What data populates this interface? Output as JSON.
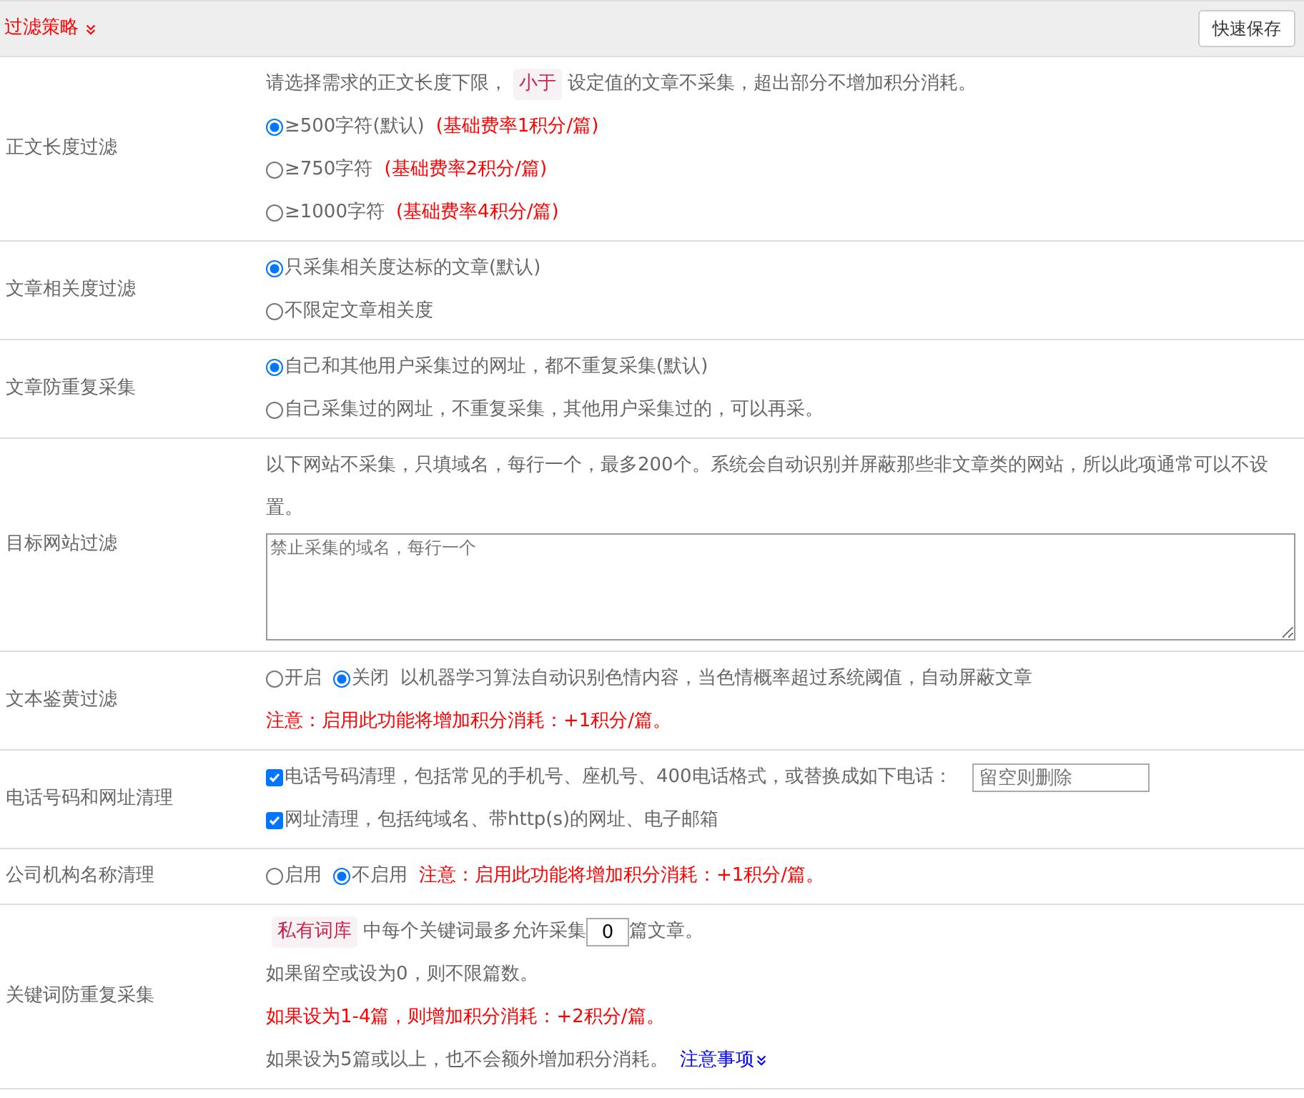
{
  "header": {
    "title": "过滤策略",
    "save_button": "快速保存"
  },
  "rows": [
    {
      "label": "正文长度过滤",
      "lines": [
        [
          {
            "kind": "text",
            "text": "请选择需求的正文长度下限，"
          },
          {
            "kind": "tag",
            "text": "小于"
          },
          {
            "kind": "text",
            "text": "设定值的文章不采集，超出部分不增加积分消耗。"
          }
        ],
        [
          {
            "kind": "radio",
            "text": "≥500字符(默认)",
            "selected": true
          },
          {
            "kind": "note",
            "text": "(基础费率1积分/篇)"
          }
        ],
        [
          {
            "kind": "radio",
            "text": "≥750字符",
            "selected": false
          },
          {
            "kind": "note",
            "text": "(基础费率2积分/篇)"
          }
        ],
        [
          {
            "kind": "radio",
            "text": "≥1000字符",
            "selected": false
          },
          {
            "kind": "note",
            "text": "(基础费率4积分/篇)"
          }
        ]
      ]
    },
    {
      "label": "文章相关度过滤",
      "lines": [
        [
          {
            "kind": "radio",
            "text": "只采集相关度达标的文章(默认)",
            "selected": true
          }
        ],
        [
          {
            "kind": "radio",
            "text": "不限定文章相关度",
            "selected": false
          }
        ]
      ]
    },
    {
      "label": "文章防重复采集",
      "lines": [
        [
          {
            "kind": "radio",
            "text": "自己和其他用户采集过的网址，都不重复采集(默认)",
            "selected": true
          }
        ],
        [
          {
            "kind": "radio",
            "text": "自己采集过的网址，不重复采集，其他用户采集过的，可以再采。",
            "selected": false
          }
        ]
      ]
    },
    {
      "label": "目标网站过滤",
      "lines": [
        [
          {
            "kind": "text",
            "text": "以下网站不采集，只填域名，每行一个，最多200个。系统会自动识别并屏蔽那些非文章类的网站，所以此项通常可以不设置。"
          }
        ],
        [
          {
            "kind": "textarea",
            "placeholder": "禁止采集的域名，每行一个"
          }
        ]
      ]
    },
    {
      "label": "文本鉴黄过滤",
      "lines": [
        [
          {
            "kind": "radio",
            "text": "开启",
            "selected": false
          },
          {
            "kind": "radio",
            "text": "关闭",
            "selected": true
          },
          {
            "kind": "text",
            "text": "以机器学习算法自动识别色情内容，当色情概率超过系统阈值，自动屏蔽文章"
          }
        ],
        [
          {
            "kind": "note",
            "text": "注意：启用此功能将增加积分消耗：+1积分/篇。"
          }
        ]
      ]
    },
    {
      "label": "电话号码和网址清理",
      "lines": [
        [
          {
            "kind": "checkbox",
            "text": "电话号码清理，包括常见的手机号、座机号、400电话格式，或替换成如下电话：",
            "checked": true
          },
          {
            "kind": "input",
            "placeholder": "留空则删除"
          }
        ],
        [
          {
            "kind": "checkbox",
            "text": "网址清理，包括纯域名、带http(s)的网址、电子邮箱",
            "checked": true
          }
        ]
      ]
    },
    {
      "label": "公司机构名称清理",
      "lines": [
        [
          {
            "kind": "radio",
            "text": "启用",
            "selected": false
          },
          {
            "kind": "radio",
            "text": "不启用",
            "selected": true
          },
          {
            "kind": "note",
            "text": "注意：启用此功能将增加积分消耗：+1积分/篇。"
          }
        ]
      ]
    },
    {
      "label": "关键词防重复采集",
      "lines": [
        [
          {
            "kind": "tag",
            "text": "私有词库"
          },
          {
            "kind": "text",
            "text": "中每个关键词最多允许采集"
          },
          {
            "kind": "number",
            "value": "0"
          },
          {
            "kind": "text",
            "text": "篇文章。"
          }
        ],
        [
          {
            "kind": "text",
            "text": "如果留空或设为0，则不限篇数。"
          }
        ],
        [
          {
            "kind": "note",
            "text": "如果设为1-4篇，则增加积分消耗：+2积分/篇。"
          }
        ],
        [
          {
            "kind": "text",
            "text": "如果设为5篇或以上，也不会额外增加积分消耗。"
          },
          {
            "kind": "link",
            "text": "注意事项"
          }
        ]
      ]
    }
  ]
}
